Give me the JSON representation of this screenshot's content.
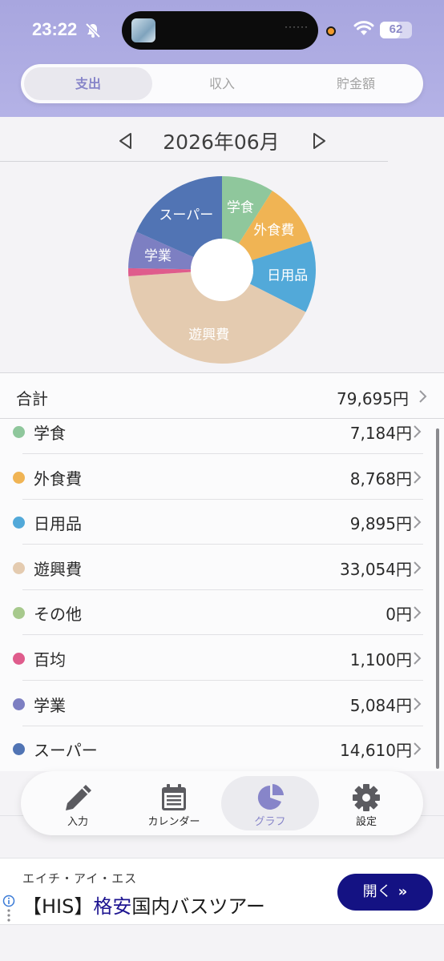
{
  "status_bar": {
    "time": "23:22",
    "battery": "62",
    "battery_level": 0.62
  },
  "segmented": {
    "tabs": [
      "支出",
      "収入",
      "貯金額"
    ],
    "active_index": 0
  },
  "month_nav": {
    "label": "2026年06月"
  },
  "summary": {
    "total_label": "合計",
    "total_value": "79,695円"
  },
  "categories": [
    {
      "name": "学食",
      "amount": "7,184円",
      "value": 7184,
      "color": "#8fc79c"
    },
    {
      "name": "外食費",
      "amount": "8,768円",
      "value": 8768,
      "color": "#f0b454"
    },
    {
      "name": "日用品",
      "amount": "9,895円",
      "value": 9895,
      "color": "#52a9d9"
    },
    {
      "name": "遊興費",
      "amount": "33,054円",
      "value": 33054,
      "color": "#e4cbb0"
    },
    {
      "name": "その他",
      "amount": "0円",
      "value": 0,
      "color": "#a7c98d"
    },
    {
      "name": "百均",
      "amount": "1,100円",
      "value": 1100,
      "color": "#df5c8c"
    },
    {
      "name": "学業",
      "amount": "5,084円",
      "value": 5084,
      "color": "#7d7fc2"
    },
    {
      "name": "スーパー",
      "amount": "14,610円",
      "value": 14610,
      "color": "#5174b4"
    }
  ],
  "tabbar": {
    "items": [
      {
        "label": "入力",
        "icon": "pencil-icon"
      },
      {
        "label": "カレンダー",
        "icon": "calendar-icon"
      },
      {
        "label": "グラフ",
        "icon": "pie-chart-icon"
      },
      {
        "label": "設定",
        "icon": "gear-icon"
      }
    ],
    "active_index": 2
  },
  "ad": {
    "subtitle": "エイチ・アイ・エス",
    "title_prefix": "【HIS】",
    "title_highlight": "格安",
    "title_suffix": "国内バスツアー",
    "button_label": "開く"
  }
}
